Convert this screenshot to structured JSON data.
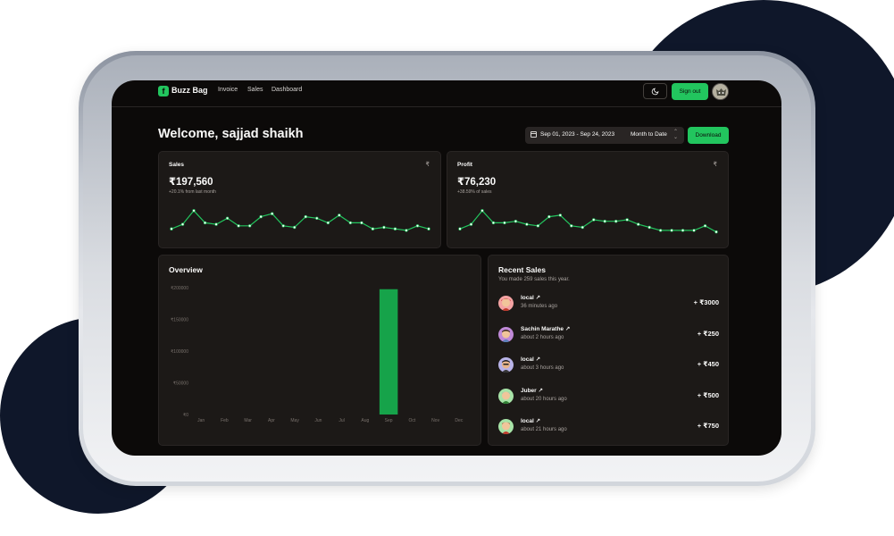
{
  "nav": {
    "brand": "Buzz Bag",
    "logo_letter": "f",
    "links": [
      "Invoice",
      "Sales",
      "Dashboard"
    ],
    "signout_label": "Sign out"
  },
  "header": {
    "welcome": "Welcome, sajjad shaikh",
    "date_range": "Sep 01, 2023 - Sep 24, 2023",
    "period": "Month to Date",
    "download_label": "Download"
  },
  "cards": {
    "sales": {
      "label": "Sales",
      "currency": "₹",
      "value": "₹197,560",
      "subtext": "+20.1% from last month"
    },
    "profit": {
      "label": "Profit",
      "currency": "₹",
      "value": "₹76,230",
      "subtext": "+38.59% of sales"
    }
  },
  "overview": {
    "title": "Overview"
  },
  "recent_sales": {
    "title": "Recent Sales",
    "subtitle": "You made 259 sales this year.",
    "items": [
      {
        "name": "local ↗",
        "time": "36 minutes ago",
        "amount": "+ ₹3000"
      },
      {
        "name": "Sachin Marathe ↗",
        "time": "about 2 hours ago",
        "amount": "+ ₹250"
      },
      {
        "name": "local ↗",
        "time": "about 3 hours ago",
        "amount": "+ ₹450"
      },
      {
        "name": "Juber ↗",
        "time": "about 20 hours ago",
        "amount": "+ ₹500"
      },
      {
        "name": "local ↗",
        "time": "about 21 hours ago",
        "amount": "+ ₹750"
      }
    ]
  },
  "colors": {
    "accent": "#22c55e",
    "bar": "#16a34a",
    "background": "#0c0a09",
    "card": "#1c1917"
  },
  "icons": {
    "theme": "moon-icon",
    "calendar": "calendar-icon",
    "chevrons": "chevron-up-down-icon"
  },
  "chart_data": [
    {
      "type": "line",
      "title": "Sales",
      "values": [
        4,
        7,
        16,
        8,
        7,
        11,
        6,
        6,
        12,
        14,
        6,
        5,
        12,
        11,
        8,
        13,
        8,
        8,
        4,
        5,
        4,
        3,
        6,
        4
      ],
      "ylim": [
        0,
        20
      ]
    },
    {
      "type": "line",
      "title": "Profit",
      "values": [
        4,
        7,
        16,
        8,
        8,
        9,
        7,
        6,
        12,
        13,
        6,
        5,
        10,
        9,
        9,
        10,
        7,
        5,
        3,
        3,
        3,
        3,
        6,
        2
      ],
      "ylim": [
        0,
        20
      ]
    },
    {
      "type": "bar",
      "title": "Overview",
      "categories": [
        "Jan",
        "Feb",
        "Mar",
        "Apr",
        "May",
        "Jun",
        "Jul",
        "Aug",
        "Sep",
        "Oct",
        "Nov",
        "Dec"
      ],
      "values": [
        0,
        0,
        0,
        0,
        0,
        0,
        0,
        0,
        197560,
        0,
        0,
        0
      ],
      "yticks": [
        "₹0",
        "₹50000",
        "₹100000",
        "₹150000",
        "₹200000"
      ],
      "ylim": [
        0,
        200000
      ]
    }
  ]
}
